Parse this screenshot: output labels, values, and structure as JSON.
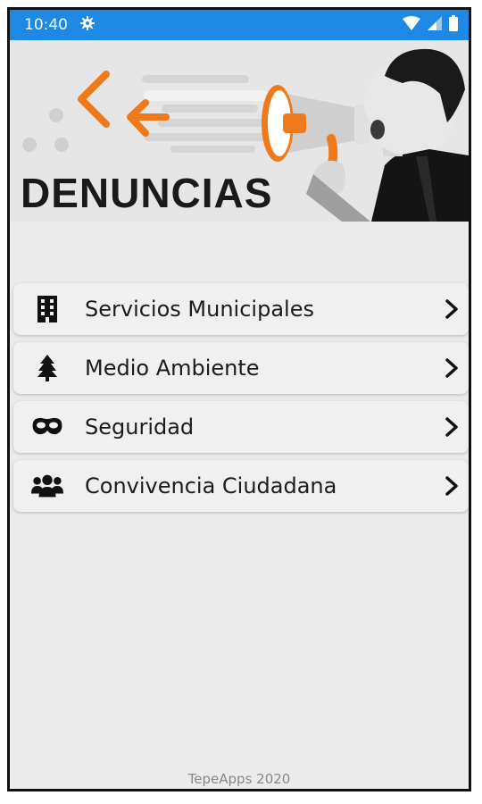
{
  "status_bar": {
    "time": "10:40",
    "settings_icon": "gear-icon",
    "wifi_icon": "wifi-icon",
    "signal_icon": "signal-icon",
    "battery_icon": "battery-icon",
    "color": "#1e88e5"
  },
  "header": {
    "title": "DENUNCIAS",
    "accent_color": "#f07a1a"
  },
  "menu": {
    "items": [
      {
        "label": "Servicios Municipales",
        "icon": "building-icon"
      },
      {
        "label": "Medio Ambiente",
        "icon": "tree-icon"
      },
      {
        "label": "Seguridad",
        "icon": "mask-icon"
      },
      {
        "label": "Convivencia Ciudadana",
        "icon": "users-icon"
      }
    ]
  },
  "footer": {
    "text": "TepeApps 2020"
  }
}
